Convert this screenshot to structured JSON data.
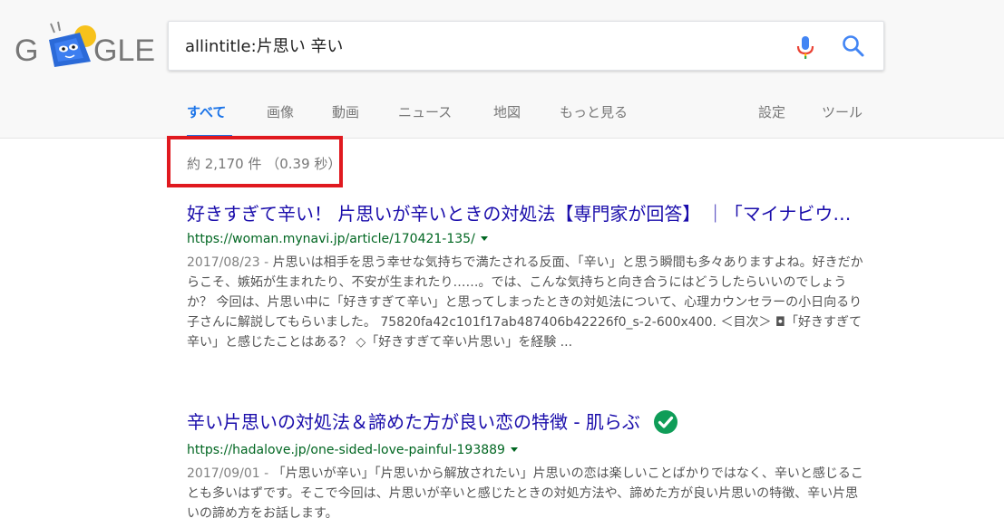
{
  "logo": {
    "left_letters": "G",
    "right_letters": "GLE"
  },
  "search": {
    "query": "allintitle:片思い 辛い"
  },
  "tabs": [
    {
      "label": "すべて",
      "active": true
    },
    {
      "label": "画像"
    },
    {
      "label": "動画"
    },
    {
      "label": "ニュース"
    },
    {
      "label": "地図"
    },
    {
      "label": "もっと見る"
    },
    {
      "label": "設定"
    },
    {
      "label": "ツール"
    }
  ],
  "result_stats": "約 2,170 件 （0.39 秒）",
  "results": [
    {
      "title": "好きすぎて辛い！ 片思いが辛いときの対処法【専門家が回答】 ｜「マイナビウーマン」",
      "url": "https://woman.mynavi.jp/article/170421-135/",
      "date": "2017/08/23 - ",
      "snippet": "片思いは相手を思う幸せな気持ちで満たされる反面、「辛い」と思う瞬間も多々ありますよね。好きだからこそ、嫉妬が生まれたり、不安が生まれたり……。では、こんな気持ちと向き合うにはどうしたらいいのでしょうか？ 今回は、片思い中に「好きすぎて辛い」と思ってしまったときの対処法について、心理カウンセラーの小日向るり子さんに解説してもらいました。 75820fa42c101f17ab487406b42226f0_s-2-600x400. ＜目次＞ ◘「好きすぎて辛い」と感じたことはある？ ◇「好きすぎて辛い片思い」を経験 ..."
    },
    {
      "title": "辛い片思いの対処法＆諦めた方が良い恋の特徴 - 肌らぶ",
      "url": "https://hadalove.jp/one-sided-love-painful-193889",
      "date": "2017/09/01 - ",
      "snippet": "「片思いが辛い」「片思いから解放されたい」片思いの恋は楽しいことばかりではなく、辛いと感じることも多いはずです。そこで今回は、片思いが辛いと感じたときの対処方法や、諦めた方が良い片思いの特徴、辛い片思いの諦め方をお話します。"
    }
  ],
  "colors": {
    "link": "#1a0dab",
    "url": "#006621",
    "active_tab": "#1a73e8",
    "highlight_box": "#e0191f",
    "check": "#0f9d58"
  }
}
